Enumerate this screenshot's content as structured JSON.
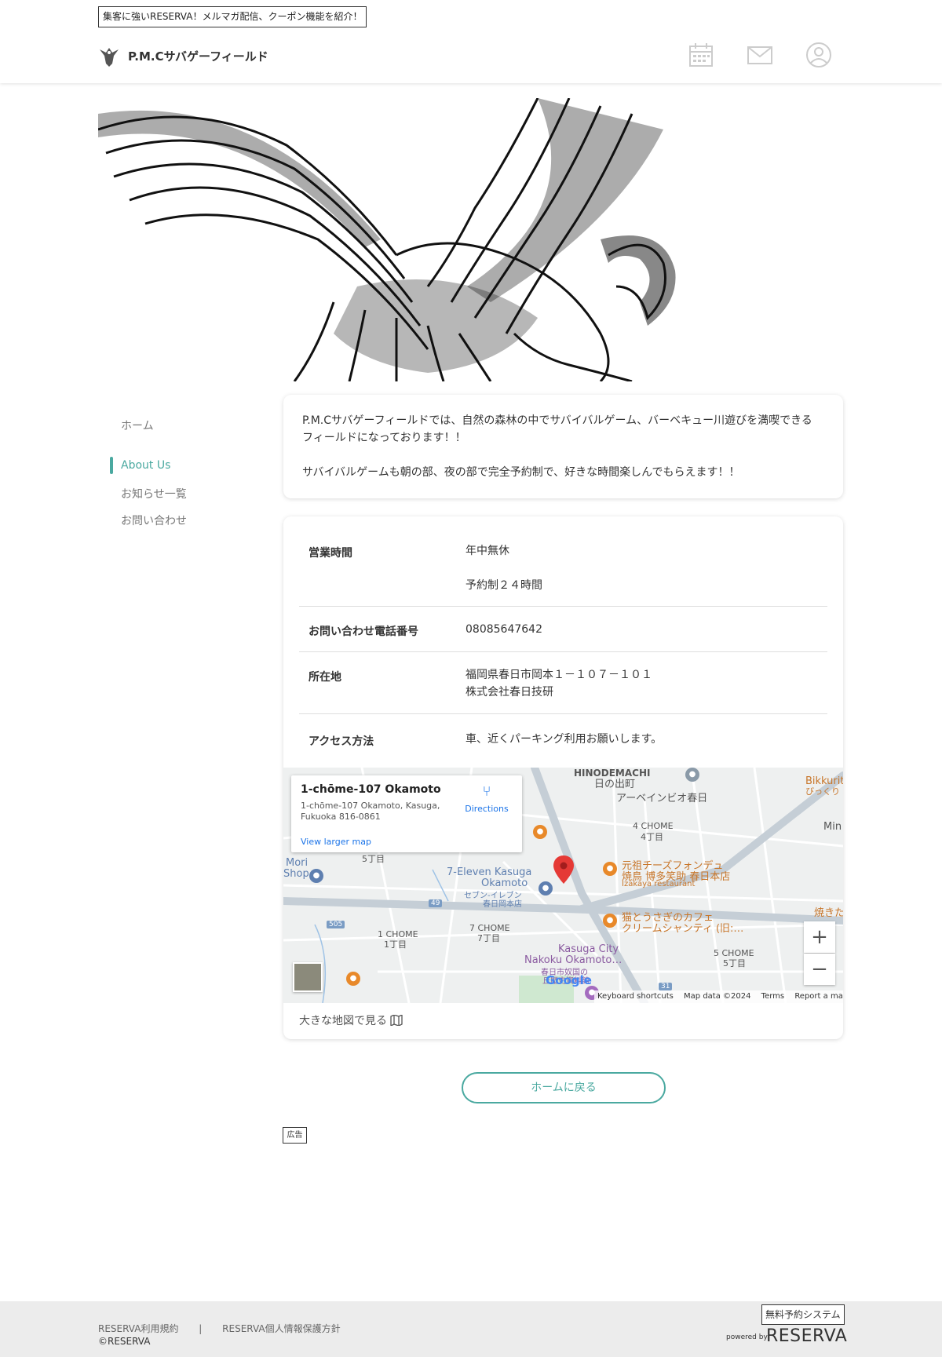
{
  "header": {
    "promo_text": "集客に強いRESERVA！メルマガ配信、クーポン機能を紹介！",
    "brand_name": "P.M.Cサバゲーフィールド",
    "icons": [
      "calendar-icon",
      "mail-icon",
      "user-icon"
    ]
  },
  "sidebar": {
    "items": [
      {
        "label": "ホーム",
        "active": false
      },
      {
        "label": "About Us",
        "active": true
      },
      {
        "label": "お知らせ一覧",
        "active": false
      },
      {
        "label": "お問い合わせ",
        "active": false
      }
    ]
  },
  "intro": {
    "line1": "P.M.Cサバゲーフィールドでは、自然の森林の中でサバイバルゲーム、バーベキュー川遊びを満喫できる",
    "line2": "フィールドになっております！！",
    "line3": "サバイバルゲームも朝の部、夜の部で完全予約制で、好きな時間楽しんでもらえます！！"
  },
  "info": {
    "rows": [
      {
        "label": "営業時間",
        "value1": "年中無休",
        "value2": "予約制２４時間"
      },
      {
        "label": "お問い合わせ電話番号",
        "value1": "08085647642"
      },
      {
        "label": "所在地",
        "value1": "福岡県春日市岡本１－１０７－１０１",
        "value2": "株式会社春日技研"
      },
      {
        "label": "アクセス方法",
        "value1": "車、近くパーキング利用お願いします。"
      }
    ],
    "map": {
      "popup_title": "1-chōme-107 Okamoto",
      "popup_addr1": "1-chōme-107 Okamoto, Kasuga,",
      "popup_addr2": "Fukuoka 816-0861",
      "popup_larger_map": "View larger map",
      "popup_directions": "Directions",
      "labels": {
        "hinodemachi": "HINODEMACHI",
        "hinodemachi_jp": "日の出町",
        "aven": "アーベインビオ春日",
        "chome4": "4 CHOME",
        "chome4_jp": "4丁目",
        "bikkuri": "Bikkurit",
        "bikkuri_jp": "びっくり",
        "mina": "Min",
        "chome5": "5丁目",
        "mori": "Mori",
        "shop": "Shop",
        "seven": "7-Eleven Kasuga",
        "okamoto": "Okamoto",
        "seven_jp": "セブン-イレブン",
        "seven_jp2": "春日岡本店",
        "cheese1": "元祖チーズフォンデュ",
        "cheese2": "焼鳥 博多笑助 春日本店",
        "izakaya": "Izakaya restaurant",
        "cafe1": "猫とうさぎのカフェ",
        "cafe2": "クリームシャンティ (旧:…",
        "yaki": "焼きた",
        "chome1": "1 CHOME",
        "chome1_jp": "1丁目",
        "chome7": "7 CHOME",
        "chome7_jp": "7丁目",
        "kasuga_city": "Kasuga City",
        "nakoku": "Nakoku Okamoto…",
        "nakoku_jp": "春日市奴国の",
        "nakoku_jp2": "丘歴史資料館",
        "chome5b": "5 CHOME",
        "chome5b_jp": "5丁目",
        "route49": "49",
        "route505": "505",
        "route31": "31"
      },
      "zoom_in": "+",
      "zoom_out": "−",
      "google": "Google",
      "attrib_shortcuts": "Keyboard shortcuts",
      "attrib_data": "Map data ©2024",
      "attrib_terms": "Terms",
      "attrib_report": "Report a map error"
    },
    "big_map_link": "大きな地図で見る"
  },
  "home_button": "ホームに戻る",
  "ad_badge": "広告",
  "footer": {
    "terms": "RESERVA利用規約",
    "separator": "|",
    "privacy": "RESERVA個人情報保護方針",
    "copyright": "©RESERVA",
    "free_badge": "無料予約システム",
    "powered_by": "powered by",
    "logo": "RESERVA"
  },
  "colors": {
    "accent": "#4aa9a0",
    "footer_bg": "#ececec"
  }
}
